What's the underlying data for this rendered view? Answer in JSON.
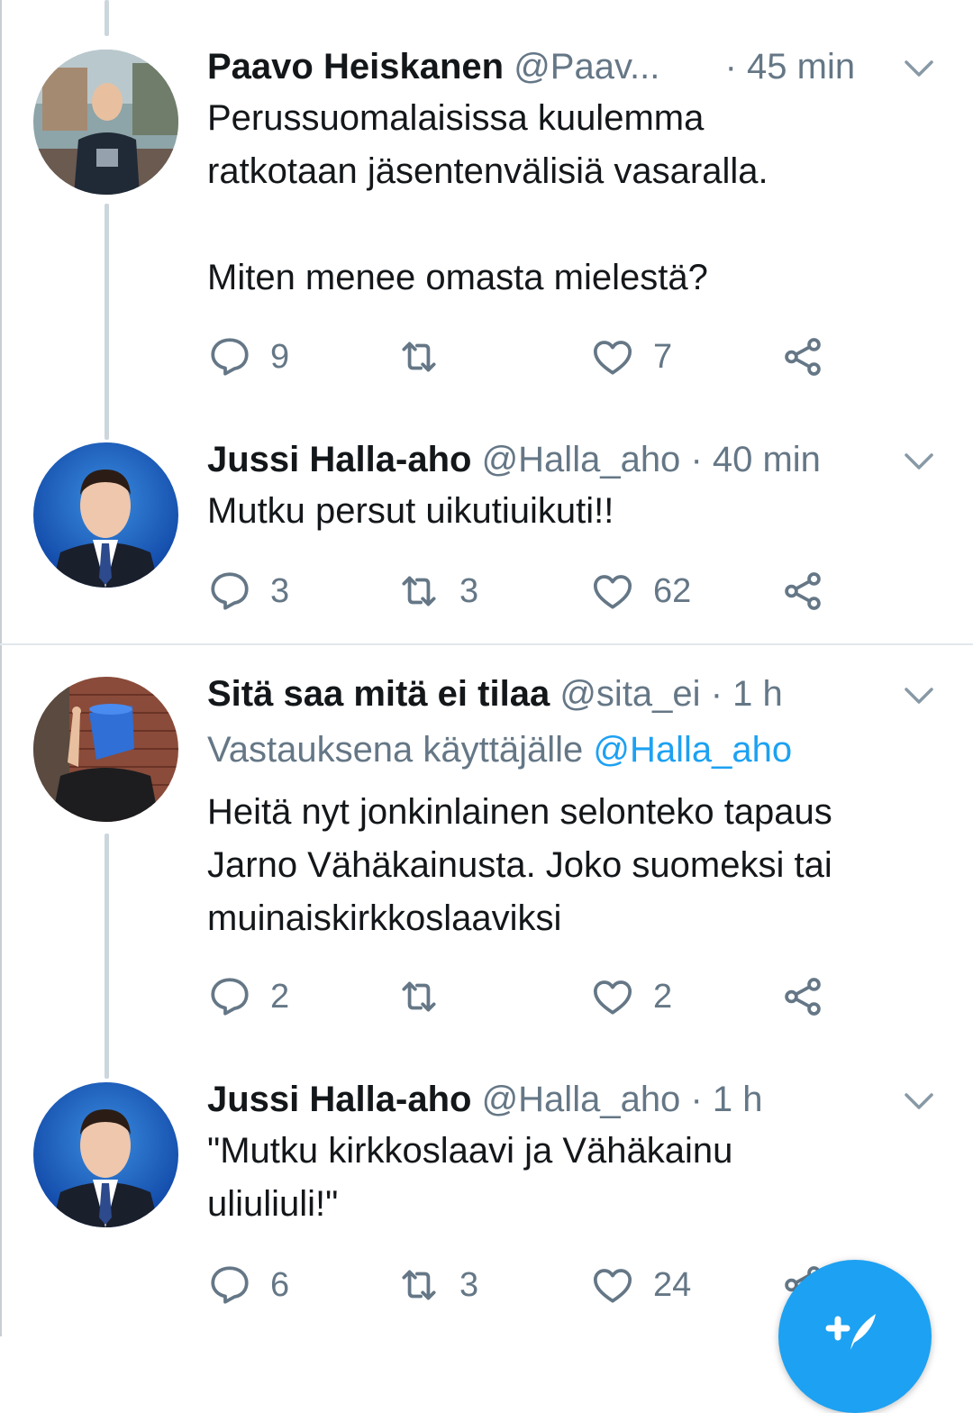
{
  "colors": {
    "accent": "#1da1f2",
    "muted": "#657786",
    "text": "#14171a",
    "thread_line": "#ccd6dd"
  },
  "tweets": [
    {
      "name": "Paavo Heiskanen",
      "handle": "@Paav...",
      "time": "· 45 min",
      "body": [
        "Perussuomalaisissa kuulemma",
        "ratkotaan jäsentenvälisiä vasaralla.",
        "",
        "Miten menee omasta mielestä?"
      ],
      "replies": "9",
      "retweets": "",
      "likes": "7"
    },
    {
      "name": "Jussi Halla-aho",
      "handle": "@Halla_aho",
      "time": "· 40 min",
      "body": [
        "Mutku persut uikutiuikuti!!"
      ],
      "replies": "3",
      "retweets": "3",
      "likes": "62"
    },
    {
      "name": "Sitä saa mitä ei tilaa",
      "handle": "@sita_ei",
      "time": "· 1 h",
      "reply_prefix": "Vastauksena käyttäjälle",
      "reply_mention": "@Halla_aho",
      "body": [
        "Heitä nyt jonkinlainen selonteko tapaus",
        "Jarno Vähäkainusta. Joko suomeksi tai",
        "muinaiskirkkoslaaviksi"
      ],
      "replies": "2",
      "retweets": "",
      "likes": "2"
    },
    {
      "name": "Jussi Halla-aho",
      "handle": "@Halla_aho",
      "time": "· 1 h",
      "body": [
        "\"Mutku kirkkoslaavi ja Vähäkainu",
        "uliuliuli!\""
      ],
      "replies": "6",
      "retweets": "3",
      "likes": "24"
    }
  ],
  "icons": [
    "reply-icon",
    "retweet-icon",
    "like-icon",
    "share-icon",
    "chevron-down-icon",
    "compose-tweet-icon"
  ]
}
